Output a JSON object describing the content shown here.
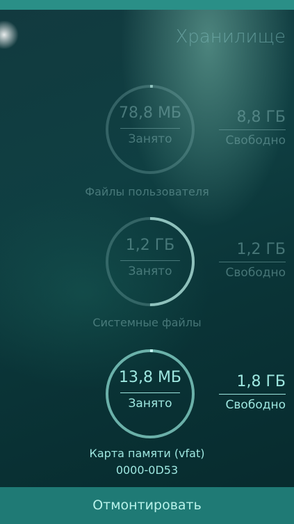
{
  "header": {
    "title": "Хранилище"
  },
  "storage": [
    {
      "used_value": "78,8 МБ",
      "used_label": "Занято",
      "free_value": "8,8 ГБ",
      "free_label": "Свободно",
      "name": "Файлы пользователя",
      "id": "",
      "used_fraction": 0.01
    },
    {
      "used_value": "1,2 ГБ",
      "used_label": "Занято",
      "free_value": "1,2 ГБ",
      "free_label": "Свободно",
      "name": "Системные файлы",
      "id": "",
      "used_fraction": 0.5
    },
    {
      "used_value": "13,8 МБ",
      "used_label": "Занято",
      "free_value": "1,8 ГБ",
      "free_label": "Свободно",
      "name": "Карта памяти (vfat)",
      "id": "0000-0D53",
      "used_fraction": 0.01
    }
  ],
  "actions": {
    "unmount_label": "Отмонтировать"
  },
  "colors": {
    "accent": "#9ee7e0",
    "dim": "#6aa7a7",
    "button_bg": "#1f7a75"
  }
}
